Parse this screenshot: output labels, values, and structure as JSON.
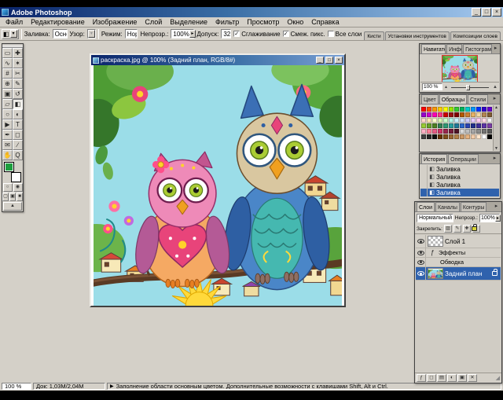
{
  "titlebar": {
    "title": "Adobe Photoshop"
  },
  "icons": {
    "dropdown_arrow": "▾",
    "spin_arrow": "▸",
    "menu_arrow": "▸",
    "tip_arrow": "▶",
    "check": "✓",
    "fx": "ƒ",
    "history_icon": "◧",
    "bucket_icon": "◧",
    "minimize": "_",
    "maximize": "□",
    "close": "×",
    "slider_small": "▴",
    "slider_big": "▲",
    "scroll_up": "▲",
    "scroll_down": "▼",
    "resize_grip": "◢",
    "standard_mode": "○",
    "quick_mask_mode": "◉",
    "screen_mode_1": "▢",
    "screen_mode_2": "▣",
    "screen_mode_3": "■",
    "imageready": "▲",
    "lock_transparency": "▨",
    "lock_image": "✎",
    "lock_position": "✚"
  },
  "menubar": [
    {
      "name": "file",
      "label": "Файл"
    },
    {
      "name": "edit",
      "label": "Редактирование"
    },
    {
      "name": "image",
      "label": "Изображение"
    },
    {
      "name": "layer",
      "label": "Слой"
    },
    {
      "name": "select",
      "label": "Выделение"
    },
    {
      "name": "filter",
      "label": "Фильтр"
    },
    {
      "name": "view",
      "label": "Просмотр"
    },
    {
      "name": "window",
      "label": "Окно"
    },
    {
      "name": "help",
      "label": "Справка"
    }
  ],
  "options": {
    "fill_label": "Заливка:",
    "fill_value": "Основной цв.",
    "pattern_label": "Узор:",
    "mode_label": "Режим:",
    "mode_value": "Нормальный",
    "opacity_label": "Непрозр.:",
    "opacity_value": "100%",
    "tolerance_label": "Допуск:",
    "tolerance_value": "32",
    "antialias_label": "Сглаживание",
    "antialias_checked": true,
    "contiguous_label": "Смеж. пикс.",
    "contiguous_checked": true,
    "all_layers_label": "Все слои",
    "all_layers_checked": false,
    "well_tabs": [
      {
        "name": "brushes",
        "label": "Кисти"
      },
      {
        "name": "tool-presets",
        "label": "Установки инструментов"
      },
      {
        "name": "layer-comps",
        "label": "Композиции слоев"
      }
    ]
  },
  "toolbox": {
    "foreground_color": "#1e9e3e",
    "background_color": "#ffffff",
    "active_tool": "paint-bucket",
    "tools": [
      {
        "name": "rectangular-marquee",
        "glyph": "▭"
      },
      {
        "name": "move",
        "glyph": "✚"
      },
      {
        "name": "lasso",
        "glyph": "∿"
      },
      {
        "name": "magic-wand",
        "glyph": "✶"
      },
      {
        "name": "crop",
        "glyph": "#"
      },
      {
        "name": "slice",
        "glyph": "✂"
      },
      {
        "name": "healing-brush",
        "glyph": "⊕"
      },
      {
        "name": "brush",
        "glyph": "✎"
      },
      {
        "name": "clone-stamp",
        "glyph": "▣"
      },
      {
        "name": "history-brush",
        "glyph": "↺"
      },
      {
        "name": "eraser",
        "glyph": "▱"
      },
      {
        "name": "paint-bucket",
        "glyph": "◧"
      },
      {
        "name": "blur",
        "glyph": "○"
      },
      {
        "name": "dodge",
        "glyph": "◐"
      },
      {
        "name": "path-selection",
        "glyph": "▶"
      },
      {
        "name": "type",
        "glyph": "T"
      },
      {
        "name": "pen",
        "glyph": "✒"
      },
      {
        "name": "shape",
        "glyph": "◻"
      },
      {
        "name": "notes",
        "glyph": "✉"
      },
      {
        "name": "eyedropper",
        "glyph": "∕"
      },
      {
        "name": "hand",
        "glyph": "✋"
      },
      {
        "name": "zoom",
        "glyph": "Q"
      }
    ]
  },
  "document": {
    "title": "раскраска.jpg @ 100% (Задний план, RGB/8#)"
  },
  "navigator": {
    "tabs": [
      "Навигатор",
      "Инфо",
      "Гистограмма"
    ],
    "zoom": "100 %"
  },
  "swatches_panel": {
    "tabs": [
      "Цвет",
      "Образцы",
      "Стили"
    ],
    "swatch_rows": [
      [
        "#ff0000",
        "#ff4d00",
        "#ff9900",
        "#ffcc00",
        "#ffff00",
        "#99e600",
        "#33cc33",
        "#00b35c",
        "#00cccc",
        "#0099ff",
        "#0033ff",
        "#3300cc",
        "#6600cc"
      ],
      [
        "#9900cc",
        "#cc00cc",
        "#ff00b3",
        "#ff3385",
        "#cc0000",
        "#991111",
        "#800000",
        "#b35900",
        "#cc8033",
        "#e6b366",
        "#f2d9a6",
        "#b38653",
        "#805c33"
      ],
      [
        "#ffd9cc",
        "#ffe6b3",
        "#ffffcc",
        "#d9f2b3",
        "#ccffcc",
        "#b3f2e6",
        "#ccf2ff",
        "#cce0ff",
        "#ccccff",
        "#e6ccff",
        "#ffccf2",
        "#ffd9e6",
        "#f2f2f2"
      ],
      [
        "#99cc33",
        "#66a329",
        "#4d8022",
        "#338055",
        "#2e9973",
        "#269e9e",
        "#1f7a99",
        "#2966cc",
        "#2944b3",
        "#1f2e8c",
        "#3d2e99",
        "#5c33a6",
        "#7a3da6"
      ],
      [
        "#ffb3c6",
        "#ff8099",
        "#e65c85",
        "#cc3366",
        "#99264d",
        "#731d3a",
        "#4d1326",
        "#d9d9d9",
        "#bfbfbf",
        "#a6a6a6",
        "#8c8c8c",
        "#737373",
        "#595959"
      ],
      [
        "#404040",
        "#262626",
        "#0d0d0d",
        "#663300",
        "#804d1a",
        "#996633",
        "#b38047",
        "#cc9966",
        "#e6b380",
        "#f2ccaa",
        "#ffe6cc",
        "#ffffff",
        "#000000"
      ]
    ]
  },
  "history": {
    "tabs": [
      "История",
      "Операции"
    ],
    "items": [
      "Заливка",
      "Заливка",
      "Заливка",
      "Заливка"
    ],
    "selected_index": 3
  },
  "layers": {
    "tabs": [
      "Слои",
      "Каналы",
      "Контуры"
    ],
    "blend_mode": "Нормальный",
    "opacity_label": "Непрозр.:",
    "opacity_value": "100%",
    "lock_label": "Закрепить:",
    "rows": [
      {
        "name": "layer-1",
        "label": "Слой 1"
      },
      {
        "name": "effects",
        "label": "Эффекты"
      },
      {
        "name": "stroke",
        "label": "Обводка"
      },
      {
        "name": "background",
        "label": "Задний план"
      }
    ]
  },
  "statusbar": {
    "zoom": "100 %",
    "doc_size": "Док: 1,03М/2,04М",
    "tip": "Заполнение области основным цветом. Дополнительные возможности с клавишами Shift, Alt и Ctrl."
  },
  "ui_colors": {
    "titlebar_start": "#0a246a",
    "titlebar_end": "#a6caf0",
    "selection_blue": "#2f62ad",
    "chrome_gray": "#d4d0c8",
    "canvas_sky": "#9bdde8"
  }
}
